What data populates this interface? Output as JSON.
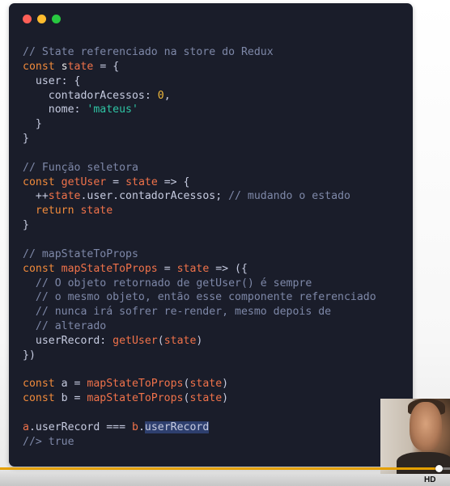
{
  "window": {
    "traffic_lights": [
      "red-dot",
      "yellow-dot",
      "green-dot"
    ],
    "background_color": "#1a1d2a"
  },
  "code": {
    "l1": "// State referenciado na store do Redux",
    "l2_kw": "const",
    "l2_a": "s",
    "l2_b": "tate",
    "l2_rest": " = {",
    "l3": "  user: {",
    "l4_key": "    contadorAcessos: ",
    "l4_num": "0",
    "l4_end": ",",
    "l5_key": "    nome: ",
    "l5_str": "'mateus'",
    "l6": "  }",
    "l7": "}",
    "l8": "",
    "l9": "// Função seletora",
    "l10_kw": "const",
    "l10_fn": "getUser",
    "l10_mid": " = ",
    "l10_var": "state",
    "l10_end": " => {",
    "l11_pre": "  ++",
    "l11_var": "state",
    "l11_mid": ".user.contadorAcessos; ",
    "l11_cmt": "// mudando o estado",
    "l12_kw": "  return",
    "l12_var": "state",
    "l13": "}",
    "l14": "",
    "l15": "// mapStateToProps",
    "l16_kw": "const",
    "l16_fn": "mapStateToProps",
    "l16_mid": " = ",
    "l16_var": "state",
    "l16_end": " => ({",
    "l17": "  // O objeto retornado de getUser() é sempre",
    "l18": "  // o mesmo objeto, então esse componente referenciado",
    "l19": "  // nunca irá sofrer re-render, mesmo depois de",
    "l20": "  // alterado",
    "l21_key": "  userRecord: ",
    "l21_fn": "getUser",
    "l21_p1": "(",
    "l21_var": "state",
    "l21_p2": ")",
    "l22": "})",
    "l23": "",
    "l24_kw": "const",
    "l24_id": " a = ",
    "l24_fn": "mapStateToProps",
    "l24_p1": "(",
    "l24_var": "state",
    "l24_p2": ")",
    "l25_kw": "const",
    "l25_id": " b = ",
    "l25_fn": "mapStateToProps",
    "l25_p1": "(",
    "l25_var": "state",
    "l25_p2": ")",
    "l26": "",
    "l27_var1": "a",
    "l27_mid": ".userRecord === ",
    "l27_var2": "b",
    "l27_dot": ".",
    "l27_hl": "userRecord",
    "l28": "//> true"
  },
  "player": {
    "progress_fraction": 0.975,
    "quality_badge": "HD",
    "accent_color": "#e5a000"
  }
}
